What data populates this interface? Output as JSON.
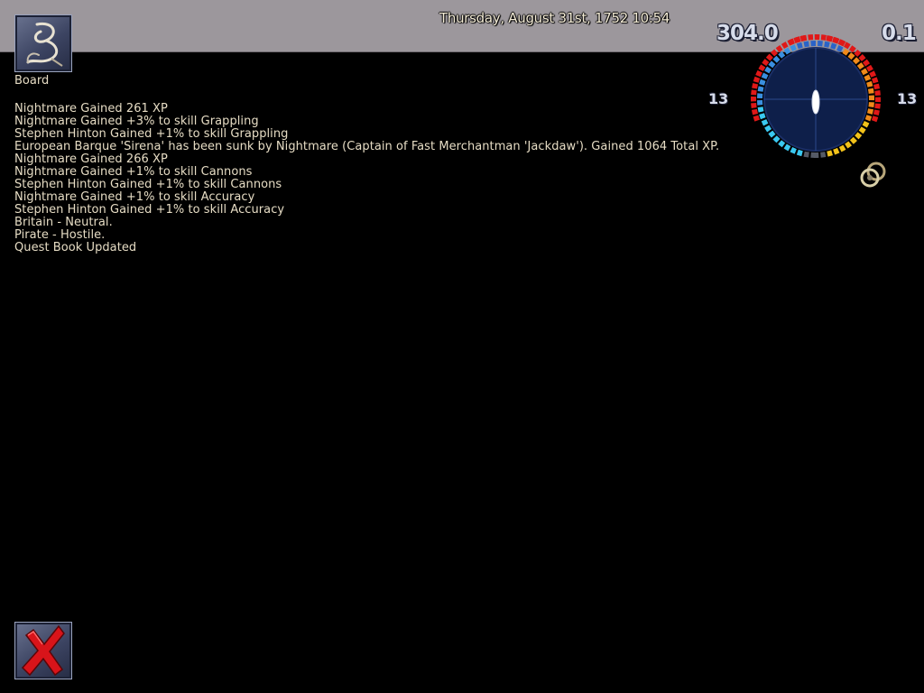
{
  "header": {
    "datetime": "Thursday, August 31st, 1752 10:54"
  },
  "board_button": {
    "label": "Board",
    "icon": "rope-grapple-icon"
  },
  "close_button": {
    "icon": "red-x-icon"
  },
  "log": [
    "Nightmare Gained 261 XP",
    "Nightmare Gained +3% to skill Grappling",
    "Stephen Hinton Gained +1% to skill Grappling",
    "European Barque 'Sirena' has been sunk by Nightmare (Captain of Fast Merchantman 'Jackdaw'). Gained 1064 Total XP.",
    "Nightmare Gained 266 XP",
    "Nightmare Gained +1% to skill Cannons",
    "Stephen Hinton Gained +1% to skill Cannons",
    "Nightmare Gained +1% to skill Accuracy",
    "Stephen Hinton Gained +1% to skill Accuracy",
    "Britain - Neutral.",
    "Pirate - Hostile.",
    "Quest Book Updated"
  ],
  "hud": {
    "speed": "304.0",
    "wind": "0.1",
    "cannons_left": "13",
    "cannons_right": "13",
    "colors": {
      "hull_ring": "#e01818",
      "sail_cool": "#3a8fe0",
      "crew_warm": "#f2c21a",
      "compass_face": "#0e1f4a"
    },
    "speed_icon": "rings-icon"
  }
}
